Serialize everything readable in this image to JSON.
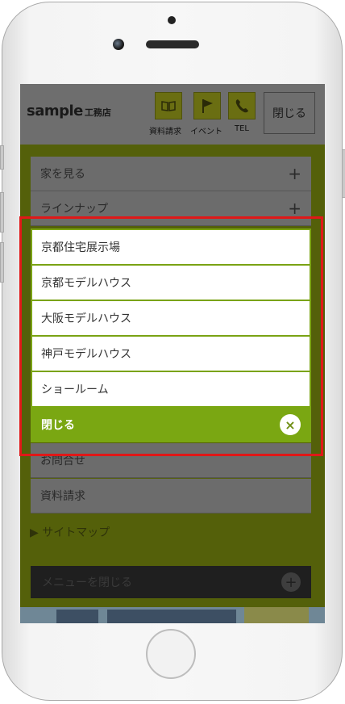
{
  "header": {
    "logo_main": "sample",
    "logo_sub": "工務店",
    "icons": [
      {
        "name": "book-icon",
        "label": "資料請求"
      },
      {
        "name": "flag-icon",
        "label": "イベント"
      },
      {
        "name": "phone-icon",
        "label": "TEL"
      }
    ],
    "close_label": "閉じる"
  },
  "menu": {
    "items": [
      {
        "label": "家を見る",
        "expand": "+"
      },
      {
        "label": "ラインナップ",
        "expand": "+"
      },
      {
        "label": "お問合せ"
      },
      {
        "label": "資料請求"
      }
    ],
    "sitemap": "▶ サイトマップ",
    "close_menu": "メニューを閉じる",
    "close_menu_icon": "+"
  },
  "submenu": {
    "items": [
      "京都住宅展示場",
      "京都モデルハウス",
      "大阪モデルハウス",
      "神戸モデルハウス",
      "ショールーム"
    ],
    "close_label": "閉じる",
    "close_icon": "×"
  },
  "colors": {
    "accent": "#7aa712",
    "highlight": "#e01818",
    "overlay_bg": "#54600a"
  }
}
